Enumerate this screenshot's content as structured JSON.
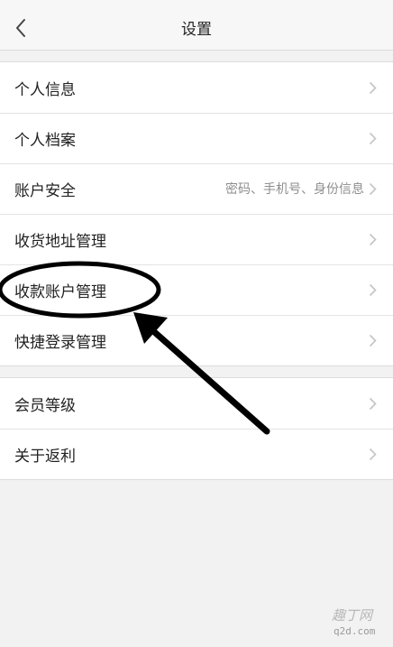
{
  "header": {
    "title": "设置",
    "back_icon": "chevron-left-icon"
  },
  "groups": [
    {
      "items": [
        {
          "label": "个人信息",
          "detail": ""
        },
        {
          "label": "个人档案",
          "detail": ""
        },
        {
          "label": "账户安全",
          "detail": "密码、手机号、身份信息"
        },
        {
          "label": "收货地址管理",
          "detail": ""
        },
        {
          "label": "收款账户管理",
          "detail": ""
        },
        {
          "label": "快捷登录管理",
          "detail": ""
        }
      ]
    },
    {
      "items": [
        {
          "label": "会员等级",
          "detail": ""
        },
        {
          "label": "关于返利",
          "detail": ""
        }
      ]
    }
  ],
  "annotation": {
    "highlighted_item": "收款账户管理",
    "color": "#000000"
  },
  "watermark": {
    "line1": "趣丁网",
    "line2": "q2d.com"
  },
  "colors": {
    "background": "#f2f2f2",
    "row_background": "#ffffff",
    "divider": "#e3e3e3",
    "detail_text": "#8e8e8e",
    "chevron": "#c4c4c4"
  }
}
